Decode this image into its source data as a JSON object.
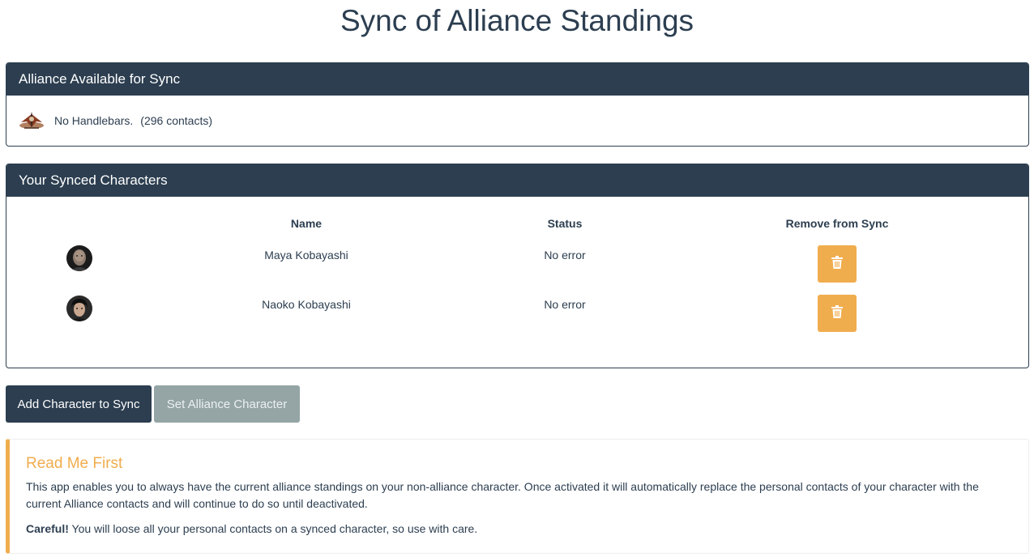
{
  "page": {
    "title": "Sync of Alliance Standings"
  },
  "alliance_panel": {
    "heading": "Alliance Available for Sync",
    "alliance_name": "No Handlebars.",
    "contacts": "(296 contacts)"
  },
  "characters_panel": {
    "heading": "Your Synced Characters",
    "columns": {
      "name": "Name",
      "status": "Status",
      "remove": "Remove from Sync"
    },
    "rows": [
      {
        "name": "Maya Kobayashi",
        "status": "No error"
      },
      {
        "name": "Naoko Kobayashi",
        "status": "No error"
      }
    ]
  },
  "actions": {
    "add_character": "Add Character to Sync",
    "set_alliance_character": "Set Alliance Character"
  },
  "readme": {
    "title": "Read Me First",
    "body": "This app enables you to always have the current alliance standings on your non-alliance character. Once activated it will automatically replace the personal contacts of your character with the current Alliance contacts and will continue to do so until deactivated.",
    "warning_label": "Careful!",
    "warning_text": " You will loose all your personal contacts on a synced character, so use with care."
  },
  "colors": {
    "primary": "#2c3e50",
    "warning": "#f0ad4e",
    "muted": "#95a5a6"
  }
}
